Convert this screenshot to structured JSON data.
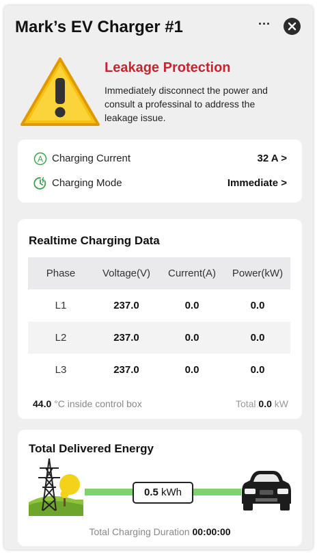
{
  "header": {
    "title": "Mark’s EV Charger #1",
    "more_label": "···"
  },
  "alert": {
    "title": "Leakage Protection",
    "message": "Immediately disconnect the power and consult a professinal to address the leakage issue.",
    "color": "#c4262e",
    "icon": "warning-triangle-icon"
  },
  "settings": {
    "charging_current": {
      "label": "Charging Current",
      "value": "32 A >"
    },
    "charging_mode": {
      "label": "Charging Mode",
      "value": "Immediate >"
    }
  },
  "realtime": {
    "title": "Realtime Charging Data",
    "columns": [
      "Phase",
      "Voltage(V)",
      "Current(A)",
      "Power(kW)"
    ],
    "rows": [
      [
        "L1",
        "237.0",
        "0.0",
        "0.0"
      ],
      [
        "L2",
        "237.0",
        "0.0",
        "0.0"
      ],
      [
        "L3",
        "237.0",
        "0.0",
        "0.0"
      ]
    ],
    "temperature_value": "44.0",
    "temperature_label": "°C inside control box",
    "total_label": "Total",
    "total_value": "0.0",
    "total_unit": "kW"
  },
  "energy": {
    "title": "Total Delivered Energy",
    "value": "0.5",
    "unit": "kWh",
    "duration_label": "Total Charging Duration",
    "duration_value": "00:00:00",
    "accent": "#7ed36a"
  }
}
